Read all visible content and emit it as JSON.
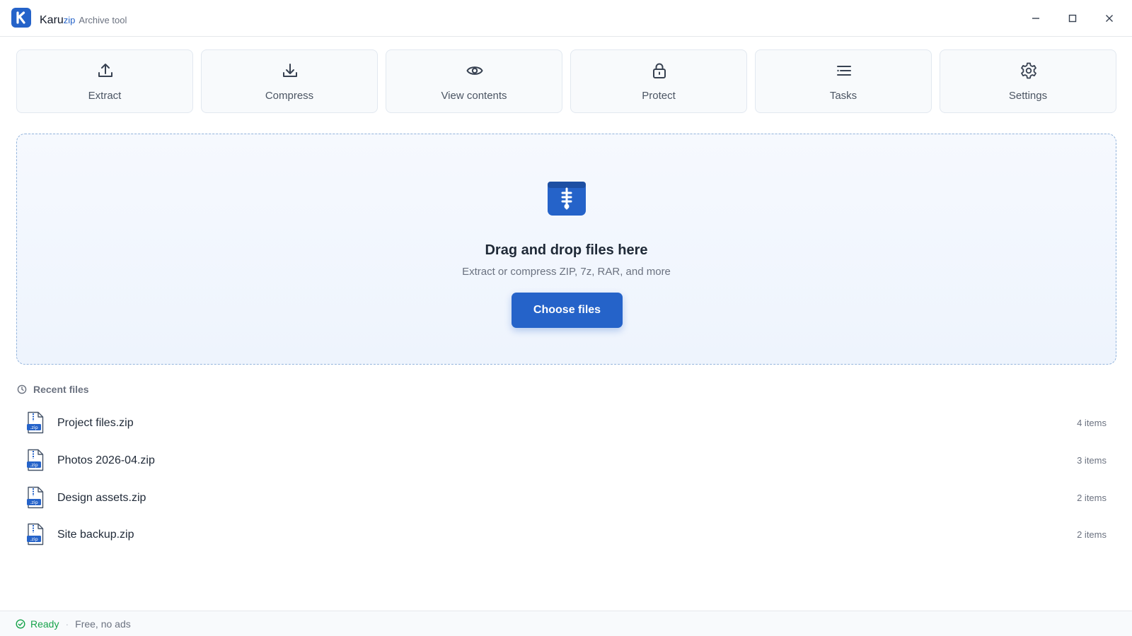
{
  "app": {
    "brand": "Karu",
    "brand_suffix": "zip",
    "subtitle": "Archive tool"
  },
  "window_controls": {
    "minimize_icon": "minimize-icon",
    "maximize_icon": "maximize-icon",
    "close_icon": "close-icon"
  },
  "toolbar": {
    "items": [
      {
        "label": "Extract",
        "icon": "upload-icon"
      },
      {
        "label": "Compress",
        "icon": "download-icon"
      },
      {
        "label": "View contents",
        "icon": "eye-icon"
      },
      {
        "label": "Protect",
        "icon": "lock-icon"
      },
      {
        "label": "Tasks",
        "icon": "list-icon"
      },
      {
        "label": "Settings",
        "icon": "gear-icon"
      }
    ]
  },
  "dropzone": {
    "icon": "archive-zipper-icon",
    "title": "Drag and drop files here",
    "subtitle": "Extract or compress ZIP, 7z, RAR, and more",
    "button_label": "Choose files"
  },
  "recent": {
    "title": "Recent files",
    "icon": "clock-icon",
    "files": [
      {
        "name": "Project files.zip",
        "count": "4 items",
        "icon": "zip-file-icon"
      },
      {
        "name": "Photos 2026-04.zip",
        "count": "3 items",
        "icon": "zip-file-icon"
      },
      {
        "name": "Design assets.zip",
        "count": "2 items",
        "icon": "zip-file-icon"
      },
      {
        "name": "Site backup.zip",
        "count": "2 items",
        "icon": "zip-file-icon"
      }
    ],
    "zip_badge": ".zip"
  },
  "status": {
    "state": "Ready",
    "separator": "·",
    "note": "Free, no ads",
    "icon": "check-circle-icon"
  },
  "colors": {
    "accent": "#2563c9",
    "success": "#16a34a",
    "muted_text": "#6b7280"
  }
}
